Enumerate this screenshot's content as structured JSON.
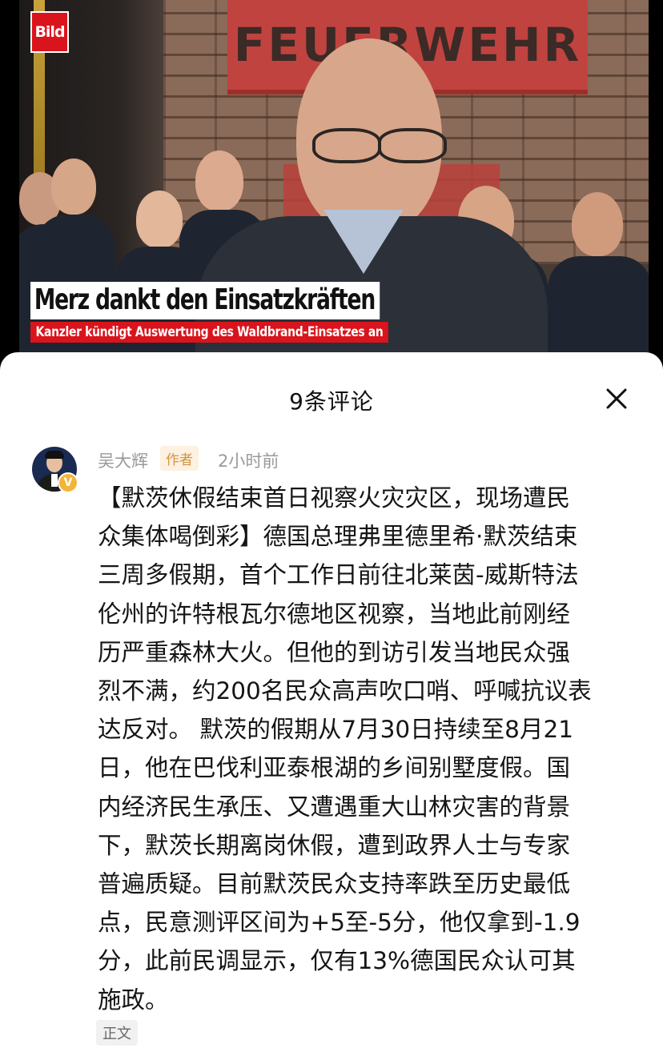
{
  "video": {
    "logo_text": "Bild",
    "sign_text": "FEUERWEHR",
    "headline": "Merz dankt den Einsatzkräften",
    "subheadline": "Kanzler kündigt Auswertung des Waldbrand-Einsatzes an"
  },
  "comments_panel": {
    "title": "9条评论",
    "close_icon": "close-icon"
  },
  "comment": {
    "author": "吴大辉",
    "author_tag": "作者",
    "time": "2小时前",
    "verified_badge": "V",
    "text": "【默茨休假结束首日视察火灾灾区，现场遭民\n众集体喝倒彩】德国总理弗里德里希·默茨结束\n三周多假期，首个工作日前往北莱茵-威斯特法\n伦州的许特根瓦尔德地区视察，当地此前刚经\n历严重森林大火。但他的到访引发当地民众强\n烈不满，约200名民众高声吹口哨、呼喊抗议表\n达反对。 默茨的假期从7月30日持续至8月21\n日，他在巴伐利亚泰根湖的乡间别墅度假。国\n内经济民生承压、又遭遇重大山林灾害的背景\n下，默茨长期离岗休假，遭到政界人士与专家\n普遍质疑。目前默茨民众支持率跌至历史最低\n点，民意测评区间为+5至-5分，他仅拿到-1.9\n分，此前民调显示，仅有13%德国民众认可其\n施政。",
    "chip_label": "正文"
  }
}
